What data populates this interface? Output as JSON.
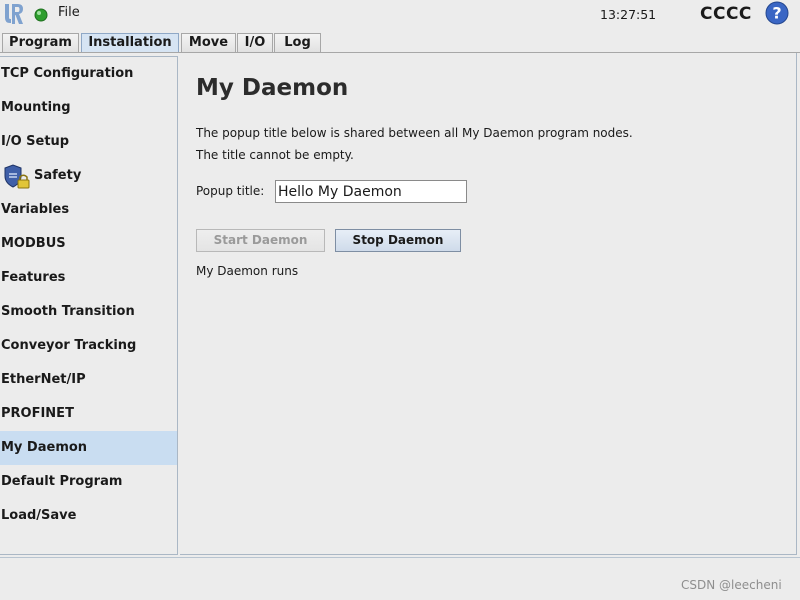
{
  "topbar": {
    "file_label": "File",
    "clock": "13:27:51",
    "robot_name": "CCCC",
    "help_glyph": "?"
  },
  "tabs": [
    {
      "label": "Program",
      "active": false
    },
    {
      "label": "Installation",
      "active": true
    },
    {
      "label": "Move",
      "active": false
    },
    {
      "label": "I/O",
      "active": false
    },
    {
      "label": "Log",
      "active": false
    }
  ],
  "sidebar": {
    "items": [
      {
        "label": "TCP Configuration"
      },
      {
        "label": "Mounting"
      },
      {
        "label": "I/O Setup"
      },
      {
        "label": "Safety",
        "icon": "safety-shield-lock-icon"
      },
      {
        "label": "Variables"
      },
      {
        "label": "MODBUS"
      },
      {
        "label": "Features"
      },
      {
        "label": "Smooth Transition"
      },
      {
        "label": "Conveyor Tracking"
      },
      {
        "label": "EtherNet/IP"
      },
      {
        "label": "PROFINET"
      },
      {
        "label": "My Daemon",
        "selected": true
      },
      {
        "label": "Default Program"
      },
      {
        "label": "Load/Save"
      }
    ]
  },
  "main": {
    "title": "My Daemon",
    "description_line1": "The popup title below is shared between all My Daemon program nodes.",
    "description_line2": "The title cannot be empty.",
    "popup_label": "Popup title:",
    "popup_value": "Hello My Daemon",
    "start_button": "Start Daemon",
    "stop_button": "Stop Daemon",
    "status_text": "My Daemon runs"
  },
  "watermark": "CSDN @leecheni",
  "colors": {
    "selected_bg": "#c9ddf1",
    "active_tab_bg": "#d6e4f3",
    "status_green": "#2e9e2e",
    "help_blue": "#3a66c4"
  }
}
